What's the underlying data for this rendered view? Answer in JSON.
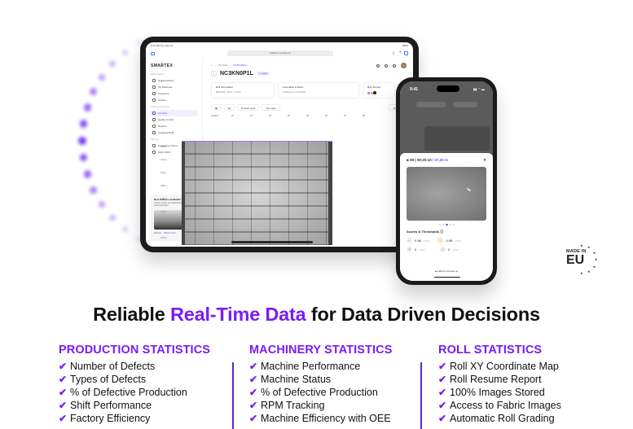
{
  "tablet": {
    "status_time": "9:41 AM  Tue Sep 14",
    "battery": "100%",
    "url": "platform.smartex.ai",
    "sidebar": {
      "logo": "SMARTEX",
      "sections": [
        {
          "title": "Digital Factory",
          "items": [
            "Digital Factory",
            "My Machines",
            "Operators",
            "Articles"
          ]
        },
        {
          "title": "Quality & Inspection",
          "items": [
            "My Rolls",
            "Quality Control",
            "Reports",
            "Assigned Rolls"
          ]
        },
        {
          "title": "Planning",
          "items": [
            "Production Orders",
            "Work Shifts"
          ]
        }
      ],
      "active_item": "My Rolls",
      "promo": {
        "title": "New features available!",
        "text": "Check out the new dashboard view. Pages now load faster.",
        "dismiss": "Dismiss",
        "link": "What's new?"
      }
    },
    "main": {
      "breadcrumb": [
        "My Rolls",
        "NC3KN0P1L"
      ],
      "title": "NC3KN0P1L",
      "badge": "• Logged",
      "info_cards": [
        {
          "title": "Roll Information",
          "sub": "08   02 Dec, 13:20 → 23:50"
        },
        {
          "title": "Anomalies & Stops",
          "sub": "3 Defects   1 in of Defects"
        },
        {
          "title": "Roll Journey",
          "sub": ""
        }
      ],
      "toolbar": {
        "infrared": "Infrared Light",
        "top": "Top Light",
        "right": "Anoma"
      },
      "grid_header": "Position",
      "cameras": [
        "01",
        "02",
        "03",
        "04",
        "05",
        "06",
        "07",
        "08"
      ],
      "positions": [
        "0,20 m",
        "0,40 m",
        "0,60 m",
        "0,80 m",
        "1,00 m",
        "1,20 m",
        "1,40 m",
        "1,60 m"
      ]
    }
  },
  "phone": {
    "time": "9:41",
    "header": {
      "camera": "08",
      "timestamp": "09:20:10",
      "distance": "/ 37,20 m"
    },
    "scores_title": "Scores & Thresholds",
    "scores": [
      {
        "value": "0.98",
        "threshold": "/ 0.67",
        "warn": false
      },
      {
        "value": "0.98",
        "threshold": "/ 0.67",
        "warn": true
      },
      {
        "value": "0",
        "threshold": "/ 0.67",
        "warn": false
      },
      {
        "value": "0",
        "threshold": "/ 0.67",
        "warn": false
      }
    ],
    "footer": "platform.smartex.ai"
  },
  "badge": {
    "made_in": "MADE IN",
    "region": "EU"
  },
  "headline": {
    "before": "Reliable ",
    "accent": "Real-Time Data",
    "after": " for Data Driven Decisions"
  },
  "columns": [
    {
      "title": "PRODUCTION STATISTICS",
      "items": [
        "Number of Defects",
        "Types of Defects",
        "% of Defective Production",
        "Shift Performance",
        "Factory Efficiency"
      ]
    },
    {
      "title": "MACHINERY STATISTICS",
      "items": [
        "Machine Performance",
        "Machine Status",
        "% of Defective Production",
        "RPM Tracking",
        "Machine Efficiency with OEE"
      ]
    },
    {
      "title": "ROLL STATISTICS",
      "items": [
        "Roll XY Coordinate Map",
        "Roll Resume Report",
        "100% Images Stored",
        "Access to Fabric Images",
        "Automatic Roll Grading"
      ]
    }
  ],
  "colors": {
    "accent": "#7a1cf5",
    "dots": "#7a3cf5"
  }
}
